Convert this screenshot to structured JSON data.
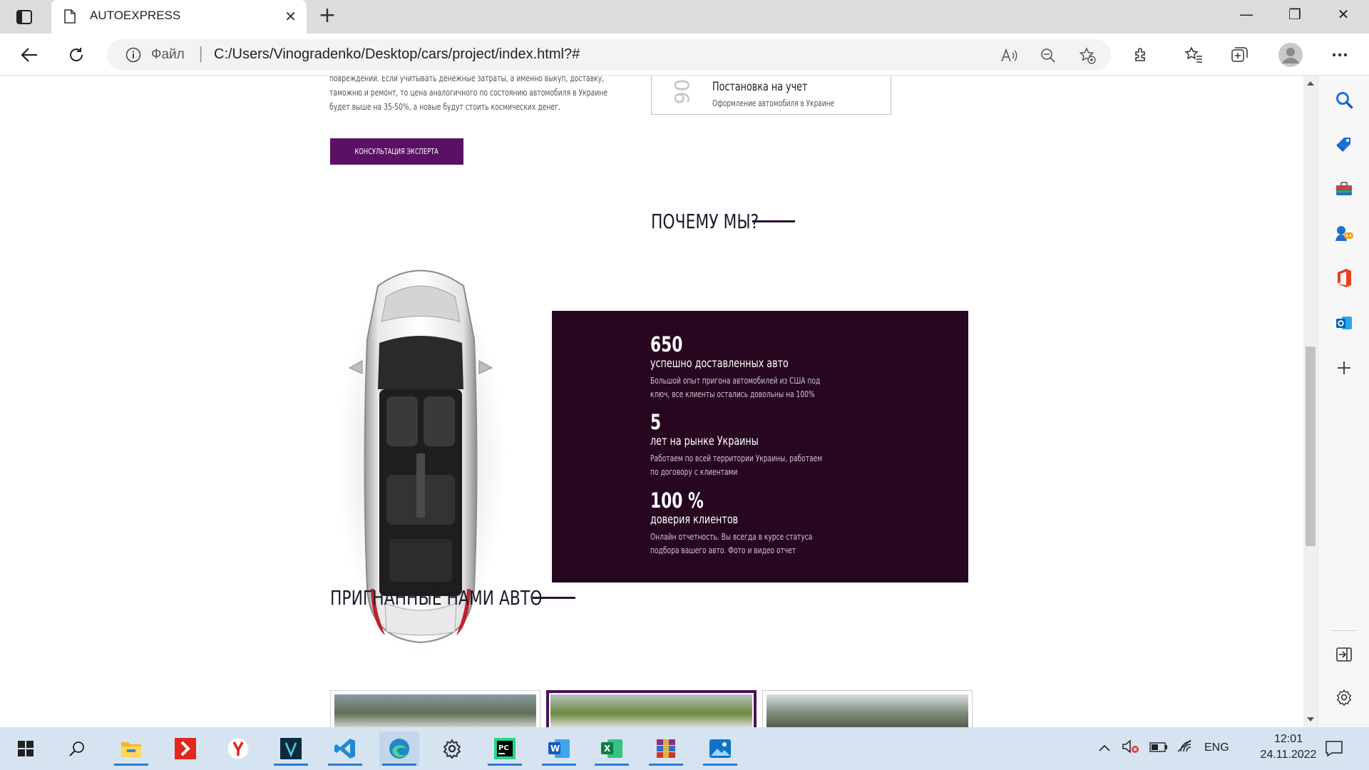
{
  "browser": {
    "tab_title": "AUTOEXPRESS",
    "address_scheme": "Файл",
    "url": "C:/Users/Vinogradenko/Desktop/cars/project/index.html?#"
  },
  "page": {
    "intro_lines": [
      "повреждений. Если учитывать денежные затраты, а именно выкуп, доставку,",
      "таможню и ремонт, то цена аналогичного по состоянию автомобиля в Украине",
      "будет выше на 35-50%, а новые будут стоить космических денег."
    ],
    "consult_button": "КОНСУЛЬТАЦИЯ ЭКСПЕРТА",
    "step": {
      "number": "06",
      "title": "Постановка на учет",
      "subtitle": "Оформление автомобиля в Украине"
    },
    "why_title": "ПОЧЕМУ МЫ?",
    "stats": [
      {
        "value": "650",
        "label": "успешно доставленных авто",
        "desc": [
          "Большой опыт пригона автомобилей из США под",
          "ключ, все клиенты остались довольны на 100%"
        ]
      },
      {
        "value": "5",
        "label": "лет на рынке Украины",
        "desc": [
          "Работаем по всей территории Украины, работаем",
          "по договору с клиентами"
        ]
      },
      {
        "value": "100 %",
        "label": "доверия клиентов",
        "desc": [
          "Онлайн отчетность. Вы всегда в курсе статуса",
          "подбора вашего авто. Фото и видео отчет"
        ]
      }
    ],
    "imported_title": "ПРИГНАННЫЕ НАМИ АВТО"
  },
  "taskbar": {
    "lang": "ENG",
    "time": "12:01",
    "date": "24.11.2022"
  },
  "colors": {
    "brand_purple": "#5a1164",
    "stats_bg": "#26071f",
    "edge_blue": "#1a73e8"
  }
}
